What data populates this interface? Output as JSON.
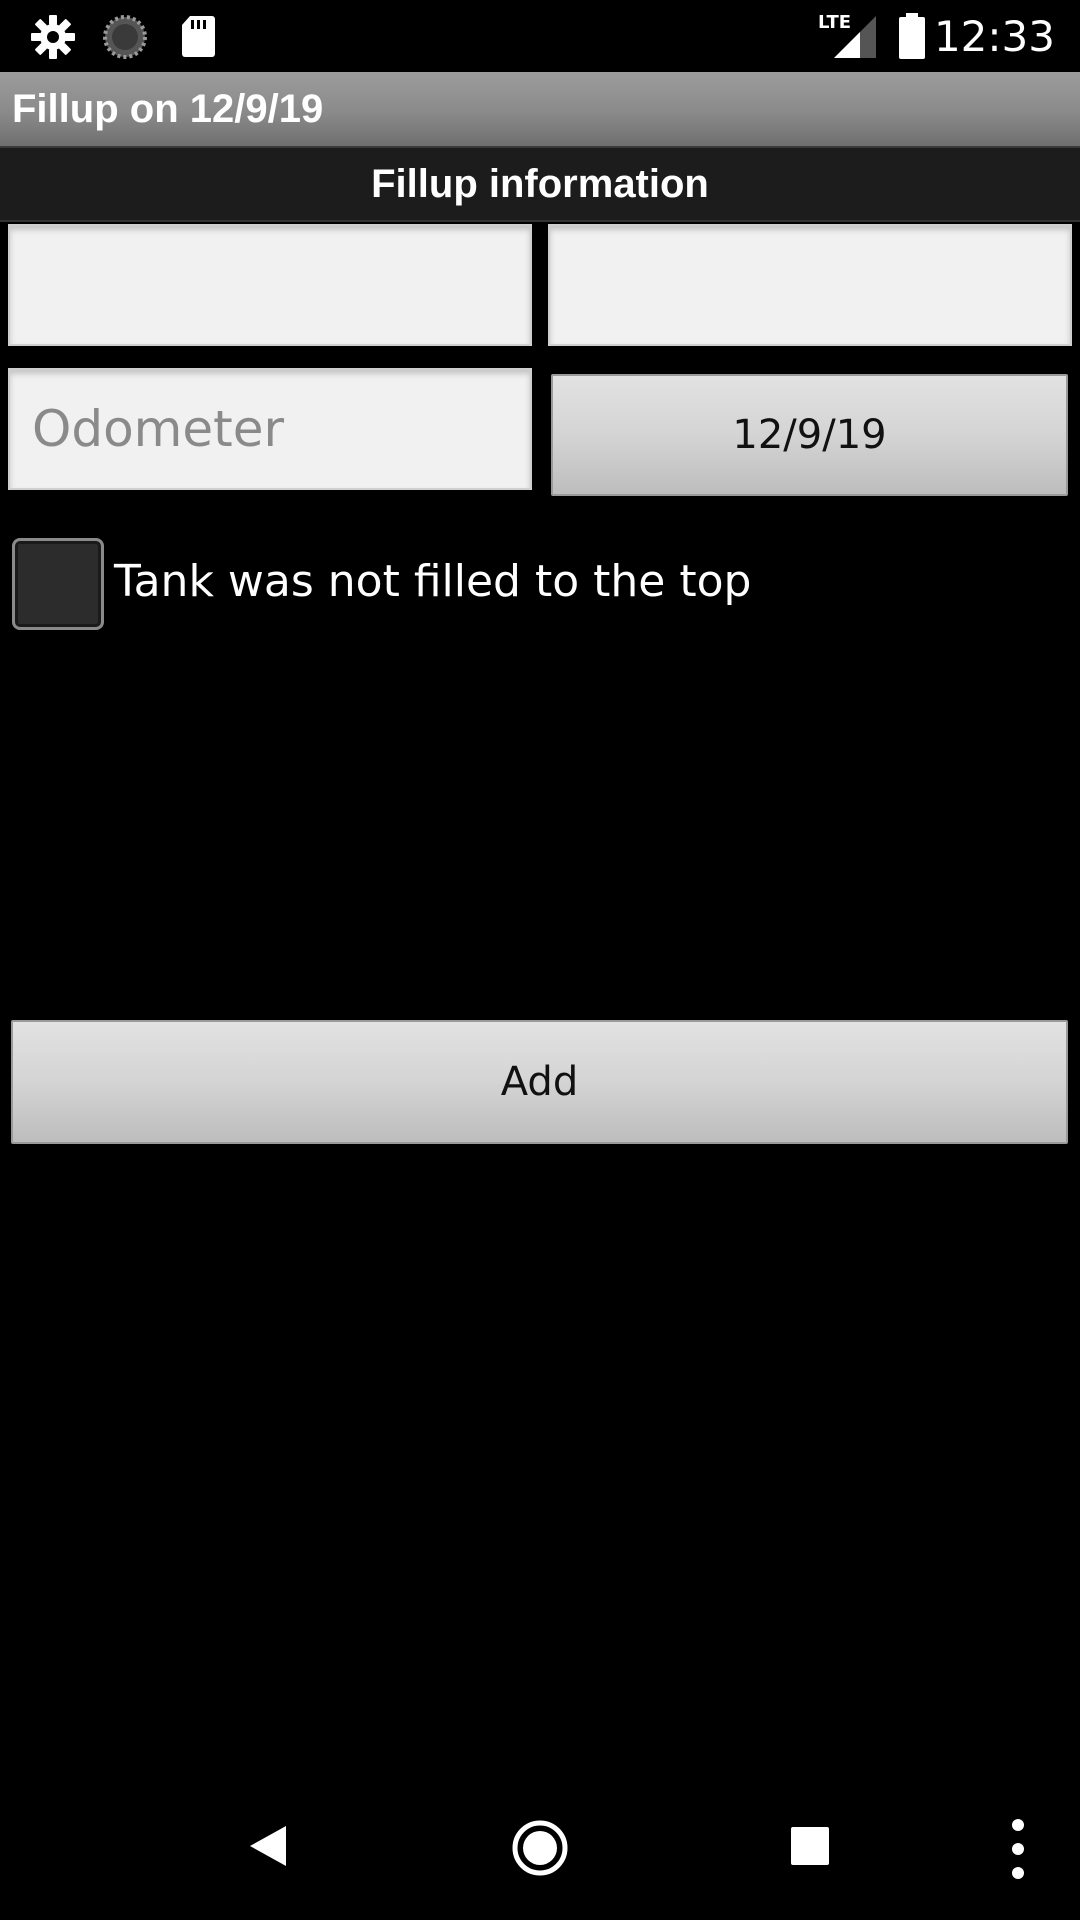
{
  "status_bar": {
    "time": "12:33",
    "network_label": "LTE",
    "icons": [
      "settings-icon",
      "sync-icon",
      "sd-card-icon",
      "signal-icon",
      "battery-icon"
    ]
  },
  "title_bar": {
    "title": "Fillup on 12/9/19"
  },
  "section": {
    "title": "Fillup information"
  },
  "form": {
    "field1": {
      "value": "",
      "placeholder": ""
    },
    "field2": {
      "value": "",
      "placeholder": ""
    },
    "odometer": {
      "value": "",
      "placeholder": "Odometer"
    },
    "date_button_label": "12/9/19",
    "partial_fill_checkbox": {
      "label": "Tank was not filled to the top",
      "checked": false
    },
    "add_button_label": "Add"
  },
  "nav_bar": {
    "icons": [
      "back-icon",
      "home-icon",
      "recents-icon",
      "overflow-menu-icon"
    ]
  },
  "colors": {
    "background": "#000000",
    "title_bar": "#8a8a8a",
    "section_header": "#1c1c1c",
    "input_bg": "#f1f1f1",
    "button_bg": "#d4d4d4"
  }
}
